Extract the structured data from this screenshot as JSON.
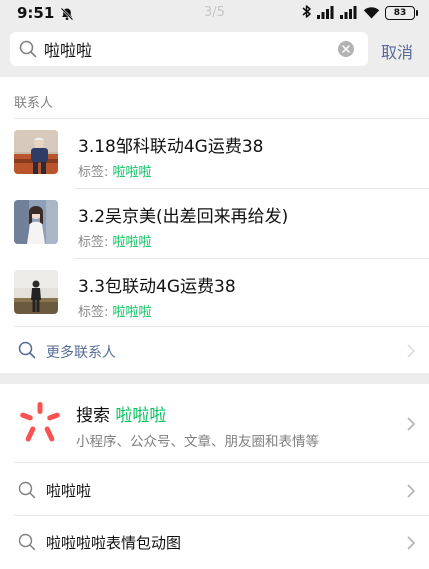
{
  "status_bar": {
    "time": "9:51",
    "pager": "3/5",
    "battery": "83",
    "icons": [
      "mute-icon",
      "bluetooth-icon",
      "signal-icon",
      "signal-icon",
      "wifi-icon",
      "battery-icon"
    ]
  },
  "search": {
    "query": "啦啦啦",
    "cancel_label": "取消"
  },
  "contacts_section": {
    "header": "联系人",
    "items": [
      {
        "name": "3.18邹科联动4G运费38",
        "tag_label": "标签: ",
        "tag_value": "啦啦啦"
      },
      {
        "name": "3.2吴京美(出差回来再给发)",
        "tag_label": "标签: ",
        "tag_value": "啦啦啦"
      },
      {
        "name": "3.3包联动4G运费38",
        "tag_label": "标签: ",
        "tag_value": "啦啦啦"
      }
    ],
    "more_label": "更多联系人"
  },
  "souyisou": {
    "title_prefix": "搜索",
    "keyword": "啦啦啦",
    "description": "小程序、公众号、文章、朋友圈和表情等"
  },
  "suggestions": [
    {
      "label": "啦啦啦"
    },
    {
      "label": "啦啦啦啦表情包动图"
    }
  ],
  "colors": {
    "accent_green": "#07c160",
    "link_blue": "#576b95",
    "logo_red": "#fa5151",
    "background": "#ededed"
  }
}
